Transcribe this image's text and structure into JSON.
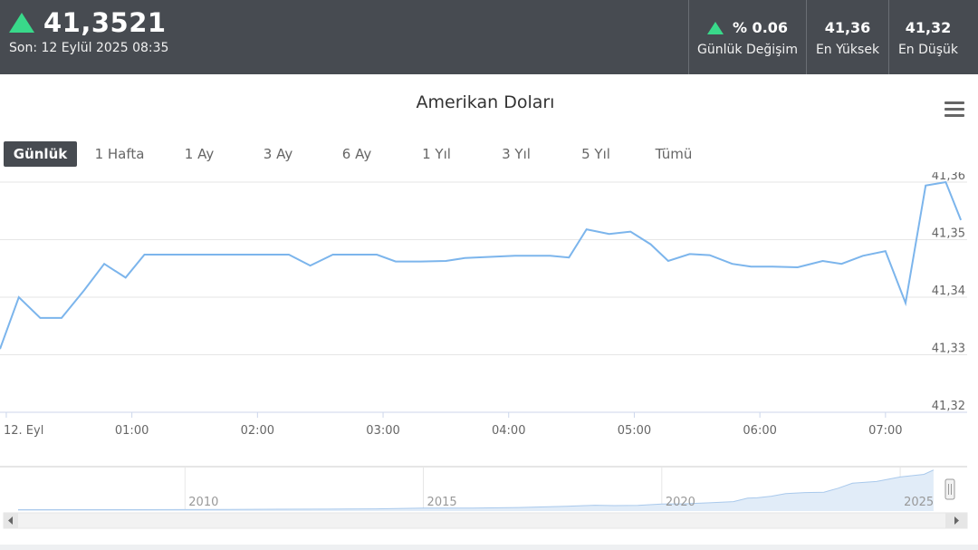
{
  "header": {
    "price": "41,3521",
    "updated": "Son: 12 Eylül 2025 08:35",
    "stats": [
      {
        "value": "% 0.06",
        "label": "Günlük Değişim",
        "arrow": "up"
      },
      {
        "value": "41,36",
        "label": "En Yüksek"
      },
      {
        "value": "41,32",
        "label": "En Düşük"
      }
    ],
    "up_color": "#39d98a"
  },
  "chart_title": "Amerikan Doları",
  "ranges": [
    "Günlük",
    "1 Hafta",
    "1 Ay",
    "3 Ay",
    "6 Ay",
    "1 Yıl",
    "3 Yıl",
    "5 Yıl",
    "Tümü"
  ],
  "active_range": "Günlük",
  "chart_data": {
    "type": "line",
    "title": "Amerikan Doları",
    "x_ticks": [
      "12. Eyl",
      "01:00",
      "02:00",
      "03:00",
      "04:00",
      "05:00",
      "06:00",
      "07:00"
    ],
    "y_ticks": [
      "41,32",
      "41,33",
      "41,34",
      "41,35",
      "41,36"
    ],
    "ylim": [
      41.32,
      41.36
    ],
    "xlim_hours": [
      -0.05,
      7.65
    ],
    "line_color": "#7cb5ec",
    "grid": true,
    "series": [
      {
        "x": [
          -0.05,
          0.1,
          0.27,
          0.44,
          0.62,
          0.78,
          0.95,
          1.1,
          1.25,
          1.45,
          1.65,
          1.85,
          2.05,
          2.25,
          2.42,
          2.6,
          2.78,
          2.95,
          3.1,
          3.3,
          3.5,
          3.65,
          3.85,
          4.05,
          4.2,
          4.33,
          4.48,
          4.62,
          4.8,
          4.97,
          5.13,
          5.27,
          5.44,
          5.6,
          5.78,
          5.93,
          6.1,
          6.3,
          6.5,
          6.65,
          6.82,
          7.0,
          7.16,
          7.32,
          7.48,
          7.6
        ],
        "y": [
          41.331,
          41.34,
          41.3364,
          41.3364,
          41.3412,
          41.3458,
          41.3434,
          41.3474,
          41.3474,
          41.3474,
          41.3474,
          41.3474,
          41.3474,
          41.3474,
          41.3455,
          41.3474,
          41.3474,
          41.3474,
          41.3462,
          41.3462,
          41.3463,
          41.3468,
          41.347,
          41.3472,
          41.3472,
          41.3472,
          41.3469,
          41.3518,
          41.351,
          41.3514,
          41.3492,
          41.3463,
          41.3475,
          41.3473,
          41.3458,
          41.3453,
          41.3453,
          41.3452,
          41.3463,
          41.3458,
          41.3472,
          41.348,
          41.339,
          41.3594,
          41.36,
          41.3534
        ]
      }
    ],
    "navigator": {
      "labels": [
        "2010",
        "2015",
        "2020",
        "2025"
      ],
      "x_years": [
        2006.5,
        2026.1
      ],
      "y_range": [
        0,
        42
      ],
      "series": {
        "x": [
          2006.5,
          2008,
          2010,
          2012,
          2013,
          2014,
          2015,
          2016,
          2017,
          2018,
          2018.6,
          2019,
          2019.5,
          2020,
          2020.5,
          2021,
          2021.5,
          2021.8,
          2022,
          2022.3,
          2022.6,
          2023,
          2023.4,
          2023.7,
          2024,
          2024.5,
          2025,
          2025.5,
          2025.7
        ],
        "y": [
          1.4,
          1.4,
          1.5,
          1.8,
          1.9,
          2.2,
          2.9,
          3.0,
          3.6,
          4.8,
          5.8,
          5.5,
          5.7,
          7.0,
          7.3,
          8.3,
          9.5,
          13.0,
          13.3,
          15.0,
          17.5,
          18.6,
          19.0,
          23.0,
          28.0,
          29.8,
          34.3,
          37.0,
          41.35
        ]
      }
    }
  }
}
